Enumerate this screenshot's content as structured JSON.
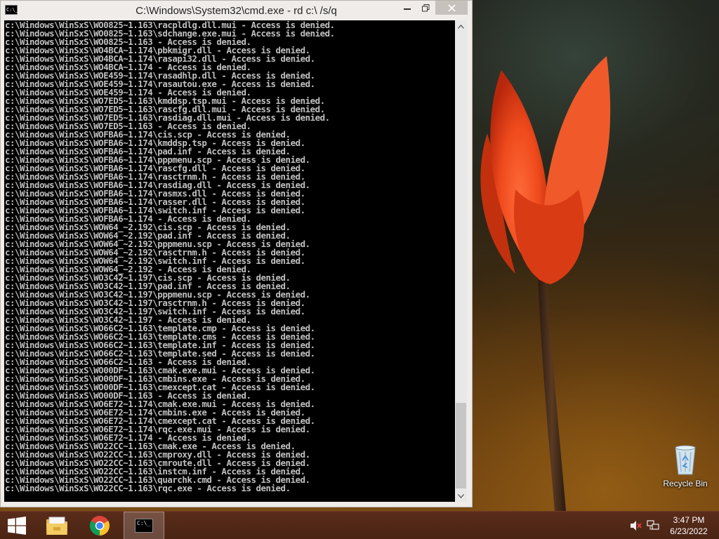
{
  "window": {
    "title": "C:\\Windows\\System32\\cmd.exe - rd  c:\\ /s/q",
    "icon_text": "C:\\_"
  },
  "console": {
    "lines": [
      "c:\\Windows\\WinSxS\\WO0825~1.163\\racpldlg.dll.mui - Access is denied.",
      "c:\\Windows\\WinSxS\\WO0825~1.163\\sdchange.exe.mui - Access is denied.",
      "c:\\Windows\\WinSxS\\WO0825~1.163 - Access is denied.",
      "c:\\Windows\\WinSxS\\WO4BCA~1.174\\pbkmigr.dll - Access is denied.",
      "c:\\Windows\\WinSxS\\WO4BCA~1.174\\rasapi32.dll - Access is denied.",
      "c:\\Windows\\WinSxS\\WO4BCA~1.174 - Access is denied.",
      "c:\\Windows\\WinSxS\\WOE459~1.174\\rasadhlp.dll - Access is denied.",
      "c:\\Windows\\WinSxS\\WOE459~1.174\\rasautou.exe - Access is denied.",
      "c:\\Windows\\WinSxS\\WOE459~1.174 - Access is denied.",
      "c:\\Windows\\WinSxS\\WO7ED5~1.163\\kmddsp.tsp.mui - Access is denied.",
      "c:\\Windows\\WinSxS\\WO7ED5~1.163\\rascfg.dll.mui - Access is denied.",
      "c:\\Windows\\WinSxS\\WO7ED5~1.163\\rasdiag.dll.mui - Access is denied.",
      "c:\\Windows\\WinSxS\\WO7ED5~1.163 - Access is denied.",
      "c:\\Windows\\WinSxS\\WOFBA6~1.174\\cis.scp - Access is denied.",
      "c:\\Windows\\WinSxS\\WOFBA6~1.174\\kmddsp.tsp - Access is denied.",
      "c:\\Windows\\WinSxS\\WOFBA6~1.174\\pad.inf - Access is denied.",
      "c:\\Windows\\WinSxS\\WOFBA6~1.174\\pppmenu.scp - Access is denied.",
      "c:\\Windows\\WinSxS\\WOFBA6~1.174\\rascfg.dll - Access is denied.",
      "c:\\Windows\\WinSxS\\WOFBA6~1.174\\rasctrnm.h - Access is denied.",
      "c:\\Windows\\WinSxS\\WOFBA6~1.174\\rasdiag.dll - Access is denied.",
      "c:\\Windows\\WinSxS\\WOFBA6~1.174\\rasmxs.dll - Access is denied.",
      "c:\\Windows\\WinSxS\\WOFBA6~1.174\\rasser.dll - Access is denied.",
      "c:\\Windows\\WinSxS\\WOFBA6~1.174\\switch.inf - Access is denied.",
      "c:\\Windows\\WinSxS\\WOFBA6~1.174 - Access is denied.",
      "c:\\Windows\\WinSxS\\WOW64_~2.192\\cis.scp - Access is denied.",
      "c:\\Windows\\WinSxS\\WOW64_~2.192\\pad.inf - Access is denied.",
      "c:\\Windows\\WinSxS\\WOW64_~2.192\\pppmenu.scp - Access is denied.",
      "c:\\Windows\\WinSxS\\WOW64_~2.192\\rasctrnm.h - Access is denied.",
      "c:\\Windows\\WinSxS\\WOW64_~2.192\\switch.inf - Access is denied.",
      "c:\\Windows\\WinSxS\\WOW64_~2.192 - Access is denied.",
      "c:\\Windows\\WinSxS\\WO3C42~1.197\\cis.scp - Access is denied.",
      "c:\\Windows\\WinSxS\\WO3C42~1.197\\pad.inf - Access is denied.",
      "c:\\Windows\\WinSxS\\WO3C42~1.197\\pppmenu.scp - Access is denied.",
      "c:\\Windows\\WinSxS\\WO3C42~1.197\\rasctrnm.h - Access is denied.",
      "c:\\Windows\\WinSxS\\WO3C42~1.197\\switch.inf - Access is denied.",
      "c:\\Windows\\WinSxS\\WO3C42~1.197 - Access is denied.",
      "c:\\Windows\\WinSxS\\WO66C2~1.163\\template.cmp - Access is denied.",
      "c:\\Windows\\WinSxS\\WO66C2~1.163\\template.cms - Access is denied.",
      "c:\\Windows\\WinSxS\\WO66C2~1.163\\template.inf - Access is denied.",
      "c:\\Windows\\WinSxS\\WO66C2~1.163\\template.sed - Access is denied.",
      "c:\\Windows\\WinSxS\\WO66C2~1.163 - Access is denied.",
      "c:\\Windows\\WinSxS\\WO00DF~1.163\\cmak.exe.mui - Access is denied.",
      "c:\\Windows\\WinSxS\\WO00DF~1.163\\cmbins.exe - Access is denied.",
      "c:\\Windows\\WinSxS\\WO00DF~1.163\\cmexcept.cat - Access is denied.",
      "c:\\Windows\\WinSxS\\WO00DF~1.163 - Access is denied.",
      "c:\\Windows\\WinSxS\\WO6E72~1.174\\cmak.exe.mui - Access is denied.",
      "c:\\Windows\\WinSxS\\WO6E72~1.174\\cmbins.exe - Access is denied.",
      "c:\\Windows\\WinSxS\\WO6E72~1.174\\cmexcept.cat - Access is denied.",
      "c:\\Windows\\WinSxS\\WO6E72~1.174\\rqc.exe.mui - Access is denied.",
      "c:\\Windows\\WinSxS\\WO6E72~1.174 - Access is denied.",
      "c:\\Windows\\WinSxS\\WO22CC~1.163\\cmak.exe - Access is denied.",
      "c:\\Windows\\WinSxS\\WO22CC~1.163\\cmproxy.dll - Access is denied.",
      "c:\\Windows\\WinSxS\\WO22CC~1.163\\cmroute.dll - Access is denied.",
      "c:\\Windows\\WinSxS\\WO22CC~1.163\\instcm.inf - Access is denied.",
      "c:\\Windows\\WinSxS\\WO22CC~1.163\\quarchk.cmd - Access is denied.",
      "c:\\Windows\\WinSxS\\WO22CC~1.163\\rqc.exe - Access is denied."
    ]
  },
  "desktop": {
    "icons": [
      {
        "label": "Recycle Bin",
        "icon": "recycle-bin-icon"
      }
    ]
  },
  "taskbar": {
    "buttons": [
      {
        "icon": "windows-start-icon"
      },
      {
        "icon": "file-explorer-icon"
      },
      {
        "icon": "chrome-icon"
      },
      {
        "icon": "command-prompt-icon",
        "icon_text": "C:\\_",
        "active": true
      }
    ],
    "tray": {
      "icons": [
        "speaker-muted-icon",
        "network-icon"
      ],
      "time": "3:47 PM",
      "date": "6/23/2022"
    }
  },
  "colors": {
    "console_bg": "#000000",
    "console_fg": "#c0c0c0",
    "taskbar_bg": "#4f2717",
    "tulip": "#e8451a"
  }
}
